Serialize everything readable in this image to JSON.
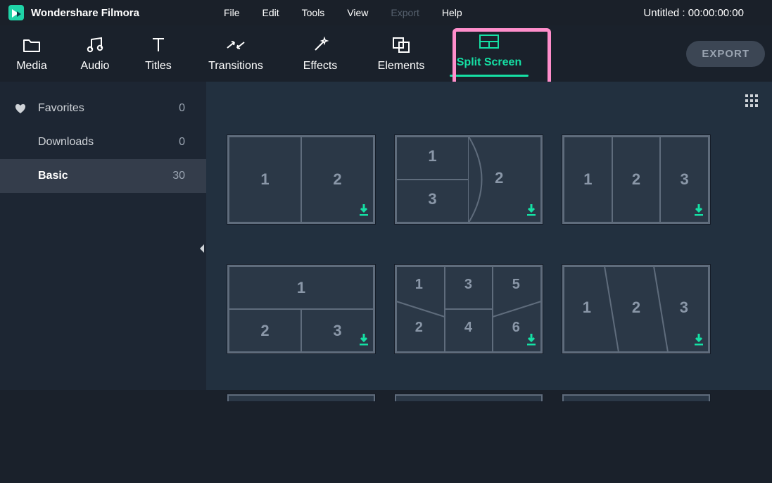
{
  "app": {
    "name": "Wondershare Filmora"
  },
  "menu": {
    "file": "File",
    "edit": "Edit",
    "tools": "Tools",
    "view": "View",
    "export": "Export",
    "help": "Help"
  },
  "doc": {
    "title": "Untitled  :  00:00:00:00"
  },
  "toolbar": {
    "media": "Media",
    "audio": "Audio",
    "titles": "Titles",
    "transitions": "Transitions",
    "effects": "Effects",
    "elements": "Elements",
    "split": "Split Screen",
    "export_btn": "EXPORT"
  },
  "sidebar": {
    "items": [
      {
        "name": "Favorites",
        "count": "0"
      },
      {
        "name": "Downloads",
        "count": "0"
      },
      {
        "name": "Basic",
        "count": "30"
      }
    ]
  },
  "thumbs": {
    "t0": {
      "n1": "1",
      "n2": "2"
    },
    "t1": {
      "n1": "1",
      "n2": "2",
      "n3": "3"
    },
    "t2": {
      "n1": "1",
      "n2": "2",
      "n3": "3"
    },
    "t3": {
      "n1": "1",
      "n2": "2",
      "n3": "3"
    },
    "t4": {
      "n1": "1",
      "n2": "2",
      "n3": "3",
      "n4": "4",
      "n5": "5",
      "n6": "6"
    },
    "t5": {
      "n1": "1",
      "n2": "2",
      "n3": "3"
    }
  }
}
